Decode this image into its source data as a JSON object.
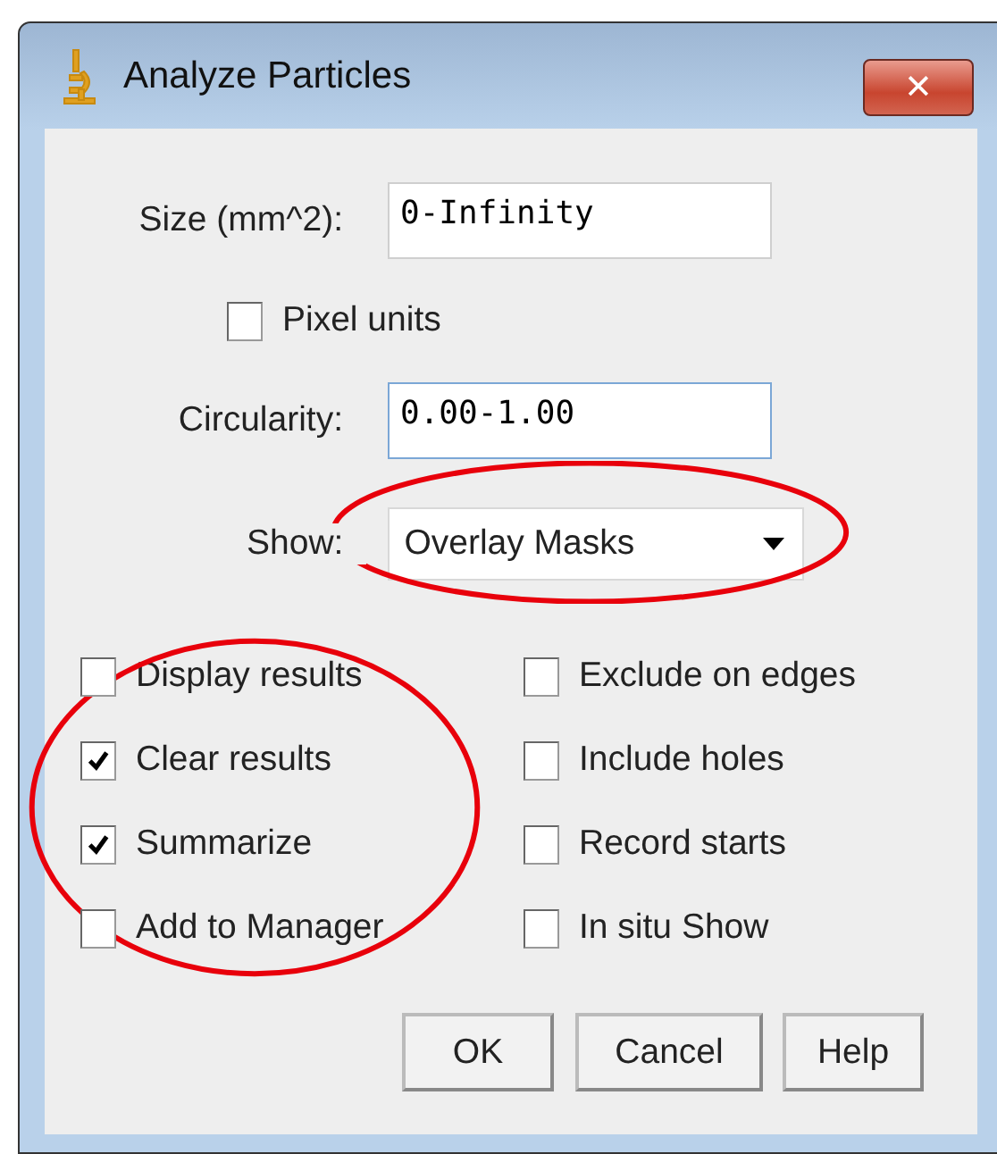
{
  "window": {
    "title": "Analyze Particles",
    "close": "✕"
  },
  "fields": [
    {
      "label": "Size (mm^2):",
      "value": "0-Infinity",
      "focused": false
    },
    {
      "label": "Circularity:",
      "value": "0.00-1.00",
      "focused": true
    }
  ],
  "pixel_units": {
    "label": "Pixel units",
    "checked": false
  },
  "show": {
    "label": "Show:",
    "value": "Overlay Masks"
  },
  "options": [
    {
      "label": "Display results",
      "checked": false
    },
    {
      "label": "Exclude on edges",
      "checked": false
    },
    {
      "label": "Clear results",
      "checked": true
    },
    {
      "label": "Include holes",
      "checked": false
    },
    {
      "label": "Summarize",
      "checked": true
    },
    {
      "label": "Record starts",
      "checked": false
    },
    {
      "label": "Add to Manager",
      "checked": false
    },
    {
      "label": "In situ Show",
      "checked": false
    }
  ],
  "buttons": [
    "OK",
    "Cancel",
    "Help"
  ],
  "annotations": [
    {
      "kind": "ellipse",
      "color": "#e8000b"
    },
    {
      "kind": "ellipse",
      "color": "#e8000b"
    }
  ]
}
